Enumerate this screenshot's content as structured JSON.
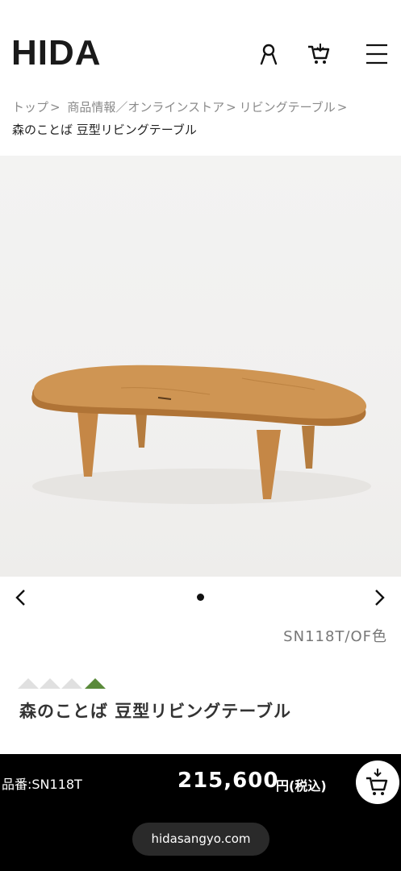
{
  "header": {
    "logo": "HIDA",
    "icons": [
      "user-icon",
      "cart-icon",
      "menu-icon"
    ]
  },
  "breadcrumb": {
    "items": [
      "トップ",
      "商品情報／オンラインストア",
      "リビングテーブル"
    ],
    "separator": ">",
    "current": "森のことば 豆型リビングテーブル"
  },
  "gallery": {
    "slide_count": 1,
    "active_slide": 1
  },
  "product": {
    "code_caption": "SN118T/OF色",
    "name": "森のことば 豆型リビングテーブル",
    "rating_marks": 4,
    "rating_filled": 1
  },
  "purchase": {
    "sku_label": "品番:SN118T",
    "price": "215,600",
    "price_unit": "円(税込)"
  },
  "browser": {
    "url": "hidasangyo.com"
  },
  "colors": {
    "accent_green": "#5a8a3a",
    "bar": "#000000",
    "wood": "#c9904f"
  }
}
